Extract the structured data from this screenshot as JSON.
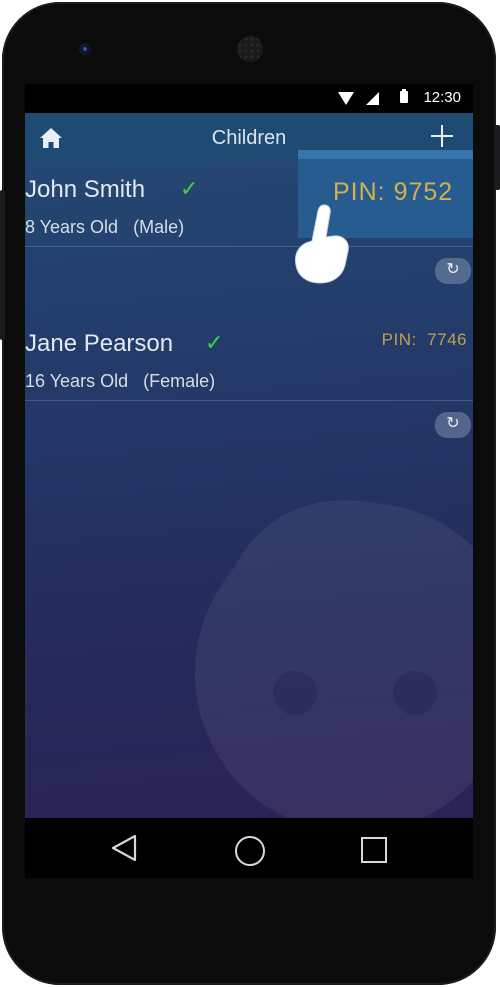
{
  "status_bar": {
    "time": "12:30",
    "icons": [
      "wifi-icon",
      "signal-icon",
      "battery-icon"
    ]
  },
  "app": {
    "title": "Children",
    "home_icon": "home-icon",
    "add_icon": "plus-icon"
  },
  "children": [
    {
      "name": "John Smith",
      "age": "8 Years Old",
      "gender": "(Male)",
      "pin_label": "PIN:",
      "pin": "9752",
      "verified": "✓"
    },
    {
      "name": "Jane Pearson",
      "age": "16 Years Old",
      "gender": "(Female)",
      "pin_label": "PIN:",
      "pin": "7746",
      "verified": "✓"
    }
  ],
  "pin_popup": {
    "text": "PIN:  9752"
  },
  "colors": {
    "accent_gold": "#c4a04a",
    "check_green": "#3ed24a",
    "topbar": "#1e4b74",
    "popup": "#275c90"
  },
  "nav_bar": {
    "icons": [
      "back-icon",
      "home-circle-icon",
      "recents-icon"
    ]
  }
}
